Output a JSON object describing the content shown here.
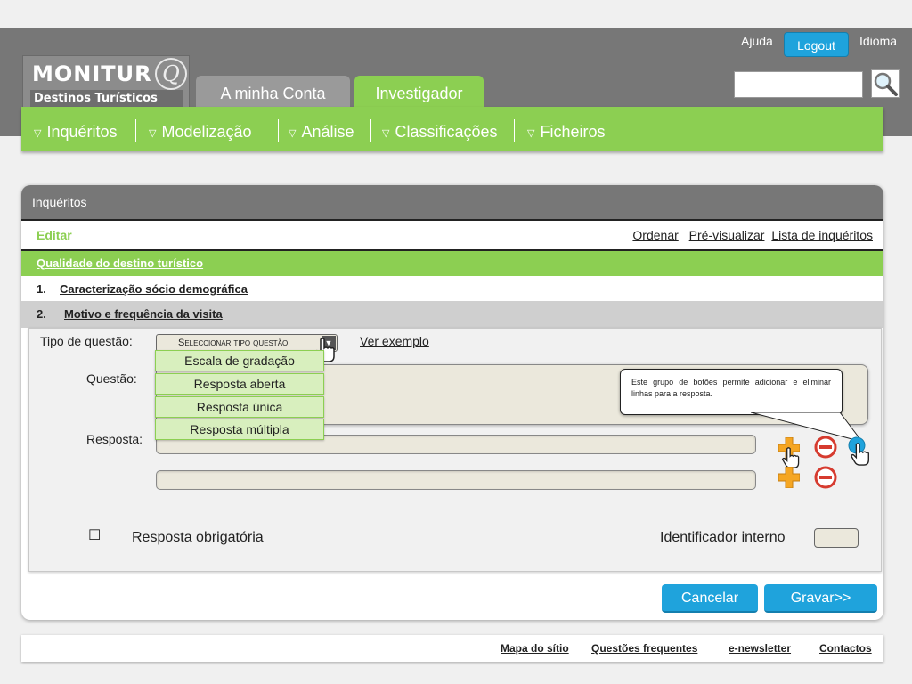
{
  "header": {
    "brand_title": "MONITUR",
    "brand_letter": "Q",
    "brand_subtitle": "Destinos Turísticos",
    "help_label": "Ajuda",
    "logout_label": "Logout",
    "language_label": "Idioma",
    "search_placeholder": "",
    "tabs": [
      {
        "label": "A minha Conta",
        "active": false
      },
      {
        "label": "Investigador",
        "active": true
      }
    ],
    "menu": [
      {
        "label": "Inquéritos"
      },
      {
        "label": "Modelização"
      },
      {
        "label": "Análise"
      },
      {
        "label": "Classificações"
      },
      {
        "label": "Ficheiros"
      }
    ],
    "menu_marker": "▽"
  },
  "panel": {
    "title": "Inquéritos",
    "mode": "Editar",
    "links": [
      "Ordenar",
      "Pré-visualizar",
      "Lista de inquéritos"
    ],
    "survey_title": "Qualidade do destino turístico",
    "sections": [
      {
        "number": "1.",
        "title": "Caracterização sócio demográfica"
      },
      {
        "number": "2.",
        "title": "Motivo e frequência da visita"
      }
    ],
    "form": {
      "question_type_label": "Tipo de questão:",
      "question_type_value": "Seleccionar tipo questão",
      "example_link": "Ver exemplo",
      "question_type_options": [
        "Escala de gradação",
        "Resposta aberta",
        "Resposta única",
        "Resposta múltipla"
      ],
      "question_label": "Questão:",
      "answer_label": "Resposta:",
      "tooltip": "Este grupo de botões permite adicionar e eliminar linhas para a resposta.",
      "required_checkbox": "☐",
      "required_label": "Resposta obrigatória",
      "internal_id_label": "Identificador interno"
    },
    "cancel_label": "Cancelar",
    "save_label": "Gravar>>"
  },
  "footer": {
    "links": [
      "Mapa do sítio",
      "Questões frequentes",
      "e-newsletter",
      "Contactos"
    ]
  },
  "colors": {
    "green": "#8ccf52",
    "blue": "#1fa3dc",
    "gray": "#777777",
    "minus_red": "#d63b2f",
    "plus_orange": "#f5a623"
  }
}
